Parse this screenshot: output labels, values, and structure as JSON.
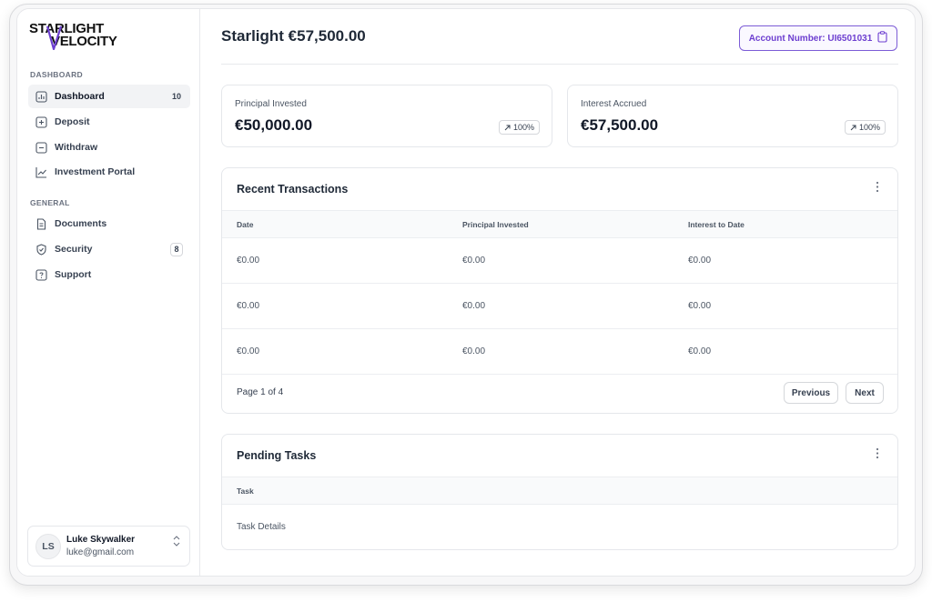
{
  "brand": {
    "line1": "STARLIGHT",
    "line2": "VELOCITY"
  },
  "sidebar": {
    "sections": [
      {
        "label": "DASHBOARD"
      },
      {
        "label": "GENERAL"
      }
    ],
    "items": [
      {
        "label": "Dashboard",
        "badge": "10"
      },
      {
        "label": "Deposit"
      },
      {
        "label": "Withdraw"
      },
      {
        "label": "Investment Portal"
      },
      {
        "label": "Documents"
      },
      {
        "label": "Security",
        "badge": "8"
      },
      {
        "label": "Support"
      }
    ]
  },
  "user": {
    "initials": "LS",
    "name": "Luke Skywalker",
    "email": "luke@gmail.com"
  },
  "header": {
    "title": "Starlight €57,500.00",
    "account_button": "Account Number: UI6501031"
  },
  "stats": [
    {
      "label": "Principal Invested",
      "value": "€50,000.00",
      "change": "100%"
    },
    {
      "label": "Interest Accrued",
      "value": "€57,500.00",
      "change": "100%"
    }
  ],
  "transactions": {
    "title": "Recent Transactions",
    "columns": [
      "Date",
      "Principal Invested",
      "Interest to Date"
    ],
    "rows": [
      [
        "€0.00",
        "€0.00",
        "€0.00"
      ],
      [
        "€0.00",
        "€0.00",
        "€0.00"
      ],
      [
        "€0.00",
        "€0.00",
        "€0.00"
      ]
    ],
    "page_info": "Page 1 of 4",
    "prev_label": "Previous",
    "next_label": "Next"
  },
  "tasks": {
    "title": "Pending Tasks",
    "columns": [
      "Task"
    ],
    "rows": [
      [
        "Task Details"
      ]
    ]
  },
  "colors": {
    "accent": "#6d3fd0",
    "accent_border": "#7c5cd6"
  }
}
